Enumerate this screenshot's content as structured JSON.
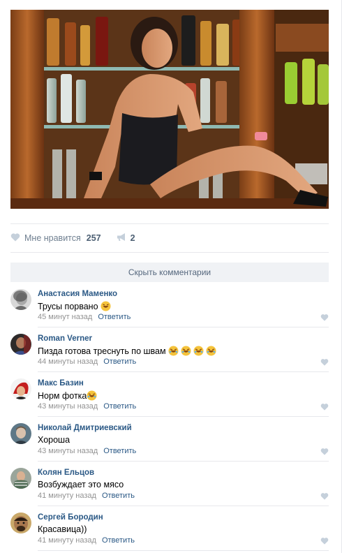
{
  "post": {
    "likes": {
      "label": "Мне нравится",
      "count": "257"
    },
    "shares": {
      "count": "2"
    },
    "hide_comments_label": "Скрыть комментарии",
    "icons": {
      "like": "heart-icon",
      "share": "megaphone-icon",
      "comment_like": "heart-icon",
      "emoji": "laughing-emoji-icon"
    },
    "colors": {
      "link": "#2a5885",
      "meta": "#939393",
      "button_bg": "#f0f2f5",
      "icon": "#c5d0db"
    }
  },
  "comments": [
    {
      "author": "Анастасия Маменко",
      "text": "Трусы порвано",
      "emoji_count": 1,
      "time": "45 минут назад",
      "reply": "Ответить"
    },
    {
      "author": "Roman Verner",
      "text": "Пизда готова треснуть по швам",
      "emoji_count": 4,
      "time": "44 минуты назад",
      "reply": "Ответить"
    },
    {
      "author": "Макс Базин",
      "text": "Норм фотка",
      "emoji_count": 1,
      "time": "43 минуты назад",
      "reply": "Ответить"
    },
    {
      "author": "Николай Дмитриевский",
      "text": "Хороша",
      "emoji_count": 0,
      "time": "43 минуты назад",
      "reply": "Ответить"
    },
    {
      "author": "Колян Ельцов",
      "text": "Возбуждает это мясо",
      "emoji_count": 0,
      "time": "41 минуту назад",
      "reply": "Ответить"
    },
    {
      "author": "Сергей Бородин",
      "text": "Красавица))",
      "emoji_count": 0,
      "time": "41 минуту назад",
      "reply": "Ответить"
    }
  ]
}
